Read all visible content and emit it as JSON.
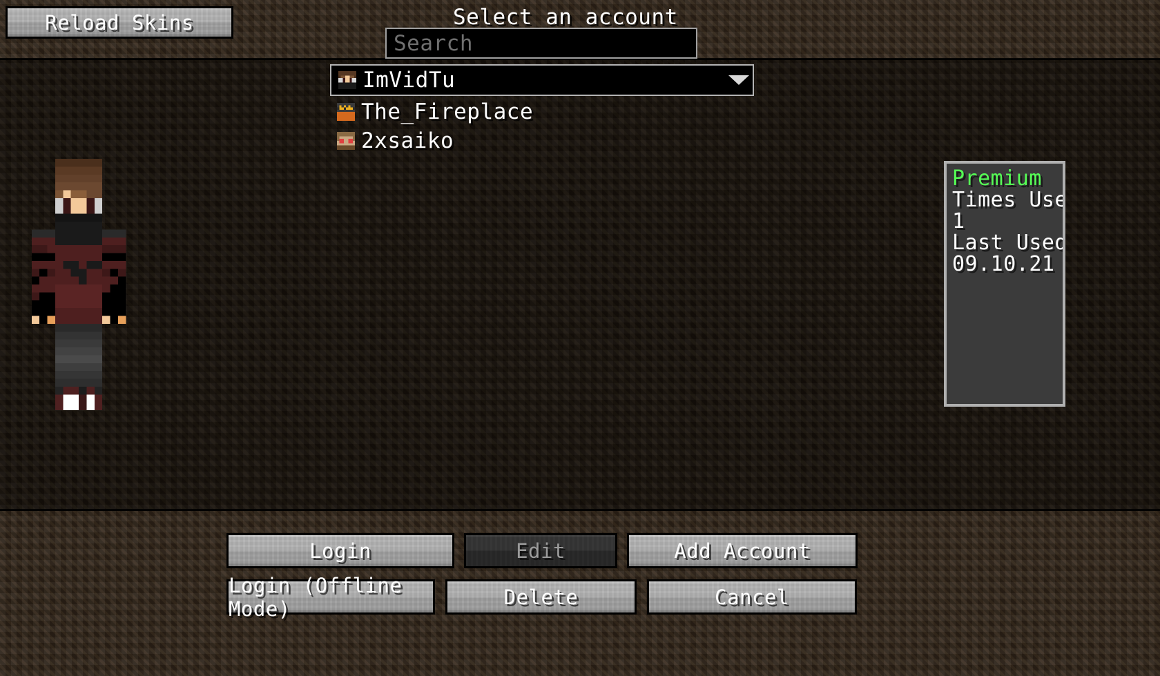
{
  "window": {
    "title": "Select an account"
  },
  "header": {
    "reload_skins_label": "Reload Skins",
    "title": "Select an account"
  },
  "search": {
    "placeholder": "Search",
    "value": ""
  },
  "accounts": {
    "selected_index": 0,
    "items": [
      {
        "name": "ImVidTu",
        "face": "imvidtu-face-icon",
        "selected": true
      },
      {
        "name": "The_Fireplace",
        "face": "the-fireplace-face-icon",
        "selected": false
      },
      {
        "name": "2xsaiko",
        "face": "2xsaiko-face-icon",
        "selected": false
      }
    ],
    "dropdown_icon": "chevron-down-icon"
  },
  "info_panel": {
    "status": "Premium",
    "times_used_label": "Times Used:",
    "times_used_value": "1",
    "last_used_label": "Last Used:",
    "last_used_value": "09.10.21"
  },
  "actions": {
    "login": "Login",
    "edit": "Edit",
    "add_account": "Add Account",
    "login_offline": "Login (Offline Mode)",
    "delete": "Delete",
    "cancel": "Cancel",
    "edit_disabled": true
  },
  "colors": {
    "status_premium": "#55ff55",
    "button_face": "#a8a8a8",
    "button_disabled_face": "#2f2f2f",
    "dirt_band": "#2e2318",
    "main_background": "#17110b",
    "panel_background": "#3b3b3b",
    "panel_border": "#b0b0b0",
    "text": "#ffffff",
    "placeholder_text": "#707070"
  },
  "skin": {
    "alt": "player-skin-render",
    "hair": "#5a3a24",
    "skin_tone": "#f3c99a",
    "eye": "#cfcfcf",
    "jacket": "#4e1f1f",
    "jacket_dark": "#121212",
    "pants": "#3a3a3a",
    "shoes": "#ffffff"
  }
}
